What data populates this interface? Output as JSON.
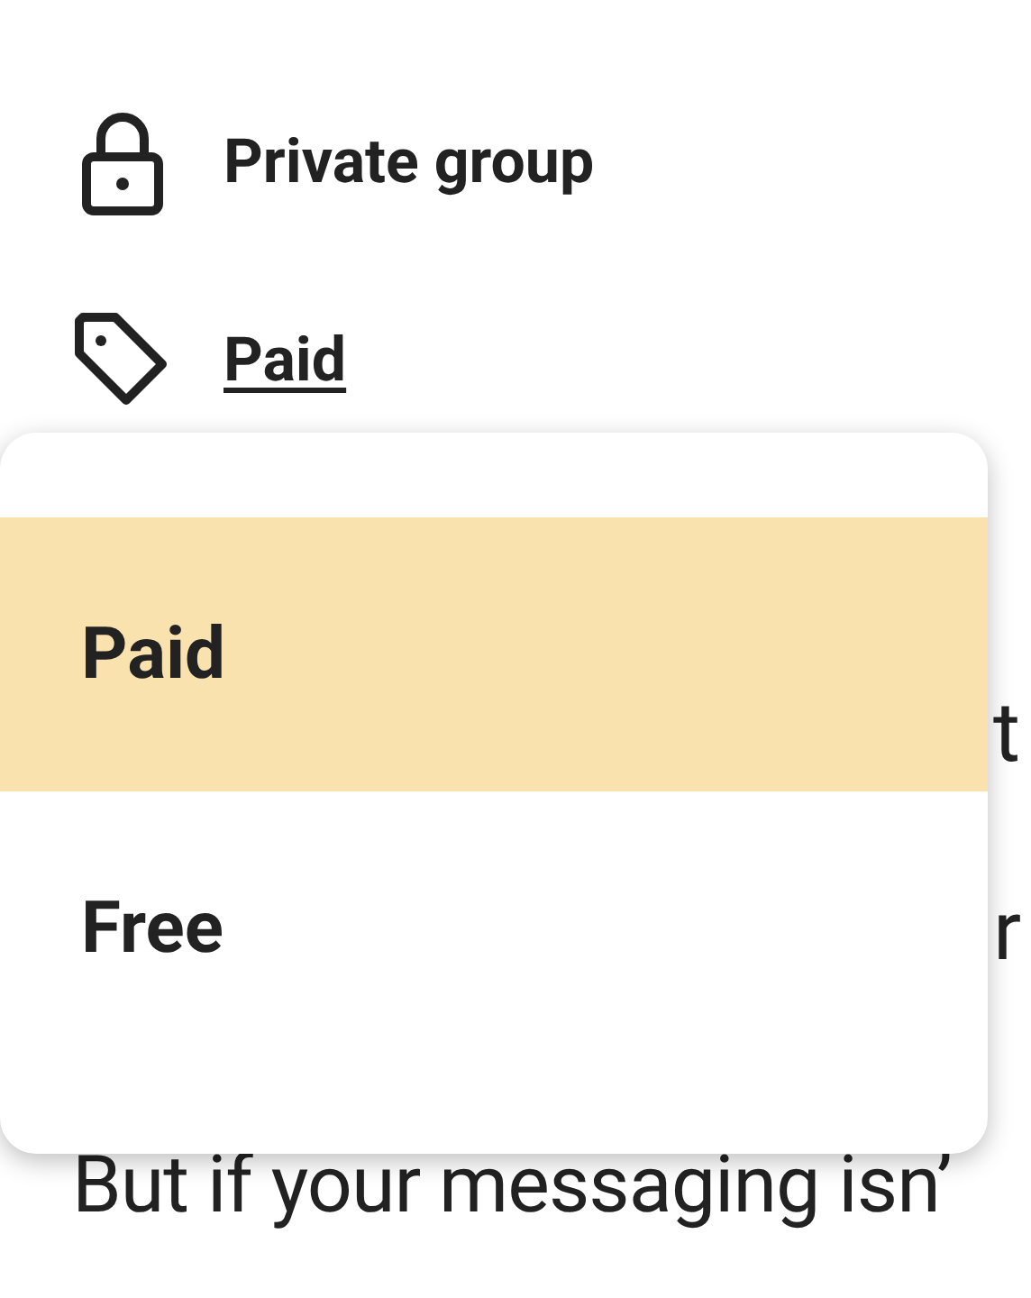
{
  "details": [
    {
      "kind": "lock",
      "label": "Private group",
      "link": false
    },
    {
      "kind": "tag",
      "label": "Paid",
      "link": true
    }
  ],
  "body_fragments": [
    {
      "text": "t",
      "kind": "edge"
    },
    {
      "text": "r",
      "kind": "edge"
    },
    {
      "text": "But if your messaging isn’",
      "kind": "line"
    }
  ],
  "menu": {
    "options": [
      {
        "label": "Paid",
        "selected": true
      },
      {
        "label": "Free",
        "selected": false
      }
    ]
  }
}
